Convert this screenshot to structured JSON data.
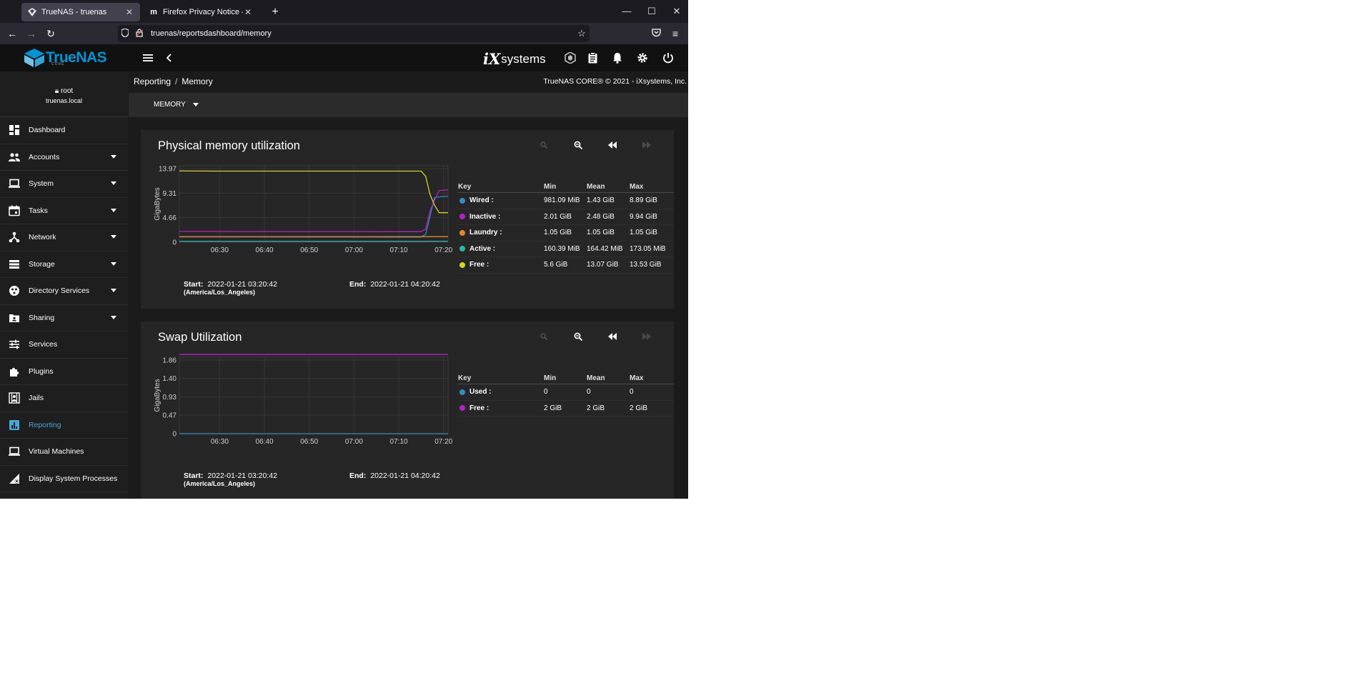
{
  "browser": {
    "tabs": [
      {
        "title": "TrueNAS - truenas",
        "icon": "truenas-favicon",
        "active": true
      },
      {
        "title": "Firefox Privacy Notice — Mozilla",
        "icon": "mozilla-favicon",
        "active": false
      }
    ],
    "url": "truenas/reportsdashboard/memory"
  },
  "header": {
    "logo_text": "TrueNAS",
    "logo_sub": "CORE",
    "brand_mark": "iX",
    "brand_text": "systems"
  },
  "user": {
    "name": "root",
    "host": "truenas.local"
  },
  "sidebar": {
    "items": [
      {
        "label": "Dashboard",
        "icon": "dashboard-icon",
        "expandable": false
      },
      {
        "label": "Accounts",
        "icon": "accounts-icon",
        "expandable": true
      },
      {
        "label": "System",
        "icon": "system-icon",
        "expandable": true
      },
      {
        "label": "Tasks",
        "icon": "tasks-icon",
        "expandable": true
      },
      {
        "label": "Network",
        "icon": "network-icon",
        "expandable": true
      },
      {
        "label": "Storage",
        "icon": "storage-icon",
        "expandable": true
      },
      {
        "label": "Directory Services",
        "icon": "directory-services-icon",
        "expandable": true
      },
      {
        "label": "Sharing",
        "icon": "sharing-icon",
        "expandable": true
      },
      {
        "label": "Services",
        "icon": "services-icon",
        "expandable": false
      },
      {
        "label": "Plugins",
        "icon": "plugins-icon",
        "expandable": false
      },
      {
        "label": "Jails",
        "icon": "jails-icon",
        "expandable": false
      },
      {
        "label": "Reporting",
        "icon": "reporting-icon",
        "expandable": false,
        "active": true
      },
      {
        "label": "Virtual Machines",
        "icon": "virtual-machines-icon",
        "expandable": false
      },
      {
        "label": "Display System Processes",
        "icon": "display-processes-icon",
        "expandable": false
      }
    ]
  },
  "main": {
    "breadcrumb": [
      "Reporting",
      "Memory"
    ],
    "copyright": "TrueNAS CORE® © 2021 - iXsystems, Inc.",
    "selector": "MEMORY"
  },
  "legend_headers": {
    "key": "Key",
    "min": "Min",
    "mean": "Mean",
    "max": "Max"
  },
  "range_labels": {
    "start": "Start:",
    "end": "End:"
  },
  "colors": {
    "accent": "#0095d5",
    "wired": "#2e8fc6",
    "inactive": "#b620c7",
    "laundry": "#e8862a",
    "active": "#2ab7b0",
    "free_yellow": "#d8d12a",
    "used": "#2e8fc6",
    "free_magenta": "#b620c7"
  },
  "chart_data": [
    {
      "type": "line",
      "title": "Physical memory utilization",
      "ylabel": "GigaBytes",
      "yticks": [
        "0",
        "4.66",
        "9.31",
        "13.97"
      ],
      "ylim": [
        0,
        13.97
      ],
      "xticks": [
        "06:30",
        "06:40",
        "06:50",
        "07:00",
        "07:10",
        "07:20"
      ],
      "x": [
        "06:21",
        "06:30",
        "06:40",
        "06:50",
        "07:00",
        "07:10",
        "07:15",
        "07:16",
        "07:17",
        "07:18",
        "07:19",
        "07:20",
        "07:21"
      ],
      "series": [
        {
          "name": "Wired",
          "color": "#2e8fc6",
          "values": [
            1.0,
            1.0,
            1.0,
            0.99,
            0.99,
            0.98,
            0.98,
            1.5,
            5.0,
            8.5,
            8.6,
            8.7,
            8.7
          ]
        },
        {
          "name": "Inactive",
          "color": "#b620c7",
          "values": [
            2.05,
            2.03,
            2.02,
            2.02,
            2.02,
            2.01,
            2.01,
            2.5,
            6.0,
            8.0,
            9.8,
            9.9,
            9.9
          ]
        },
        {
          "name": "Laundry",
          "color": "#e8862a",
          "values": [
            1.05,
            1.05,
            1.05,
            1.05,
            1.05,
            1.05,
            1.05,
            1.05,
            1.05,
            1.05,
            1.05,
            1.05,
            1.05
          ]
        },
        {
          "name": "Active",
          "color": "#2ab7b0",
          "values": [
            0.16,
            0.16,
            0.16,
            0.16,
            0.16,
            0.16,
            0.16,
            0.16,
            0.17,
            0.17,
            0.17,
            0.17,
            0.17
          ]
        },
        {
          "name": "Free",
          "color": "#d8d12a",
          "values": [
            13.53,
            13.5,
            13.5,
            13.5,
            13.5,
            13.5,
            13.5,
            12.5,
            9.0,
            7.0,
            5.6,
            5.6,
            5.6
          ]
        }
      ],
      "legend": [
        {
          "key": "Wired :",
          "min": "981.09 MiB",
          "mean": "1.43 GiB",
          "max": "8.89 GiB",
          "color": "#2e8fc6"
        },
        {
          "key": "Inactive :",
          "min": "2.01 GiB",
          "mean": "2.48 GiB",
          "max": "9.94 GiB",
          "color": "#b620c7"
        },
        {
          "key": "Laundry :",
          "min": "1.05 GiB",
          "mean": "1.05 GiB",
          "max": "1.05 GiB",
          "color": "#e8862a"
        },
        {
          "key": "Active :",
          "min": "160.39 MiB",
          "mean": "164.42 MiB",
          "max": "173.05 MiB",
          "color": "#2ab7b0"
        },
        {
          "key": "Free :",
          "min": "5.6 GiB",
          "mean": "13.07 GiB",
          "max": "13.53 GiB",
          "color": "#d8d12a"
        }
      ],
      "start": "2022-01-21 03:20:42",
      "timezone": "(America/Los_Angeles)",
      "end": "2022-01-21 04:20:42"
    },
    {
      "type": "line",
      "title": "Swap Utilization",
      "ylabel": "GigaBytes",
      "yticks": [
        "0",
        "0.47",
        "0.93",
        "1.40",
        "1.86"
      ],
      "ylim": [
        0,
        1.86
      ],
      "xticks": [
        "06:30",
        "06:40",
        "06:50",
        "07:00",
        "07:10",
        "07:20"
      ],
      "x": [
        "06:21",
        "07:21"
      ],
      "series": [
        {
          "name": "Used",
          "color": "#2e8fc6",
          "values": [
            0,
            0
          ]
        },
        {
          "name": "Free",
          "color": "#b620c7",
          "values": [
            2,
            2
          ]
        }
      ],
      "legend": [
        {
          "key": "Used :",
          "min": "0",
          "mean": "0",
          "max": "0",
          "color": "#2e8fc6"
        },
        {
          "key": "Free :",
          "min": "2 GiB",
          "mean": "2 GiB",
          "max": "2 GiB",
          "color": "#b620c7"
        }
      ],
      "start": "2022-01-21 03:20:42",
      "timezone": "(America/Los_Angeles)",
      "end": "2022-01-21 04:20:42"
    }
  ]
}
